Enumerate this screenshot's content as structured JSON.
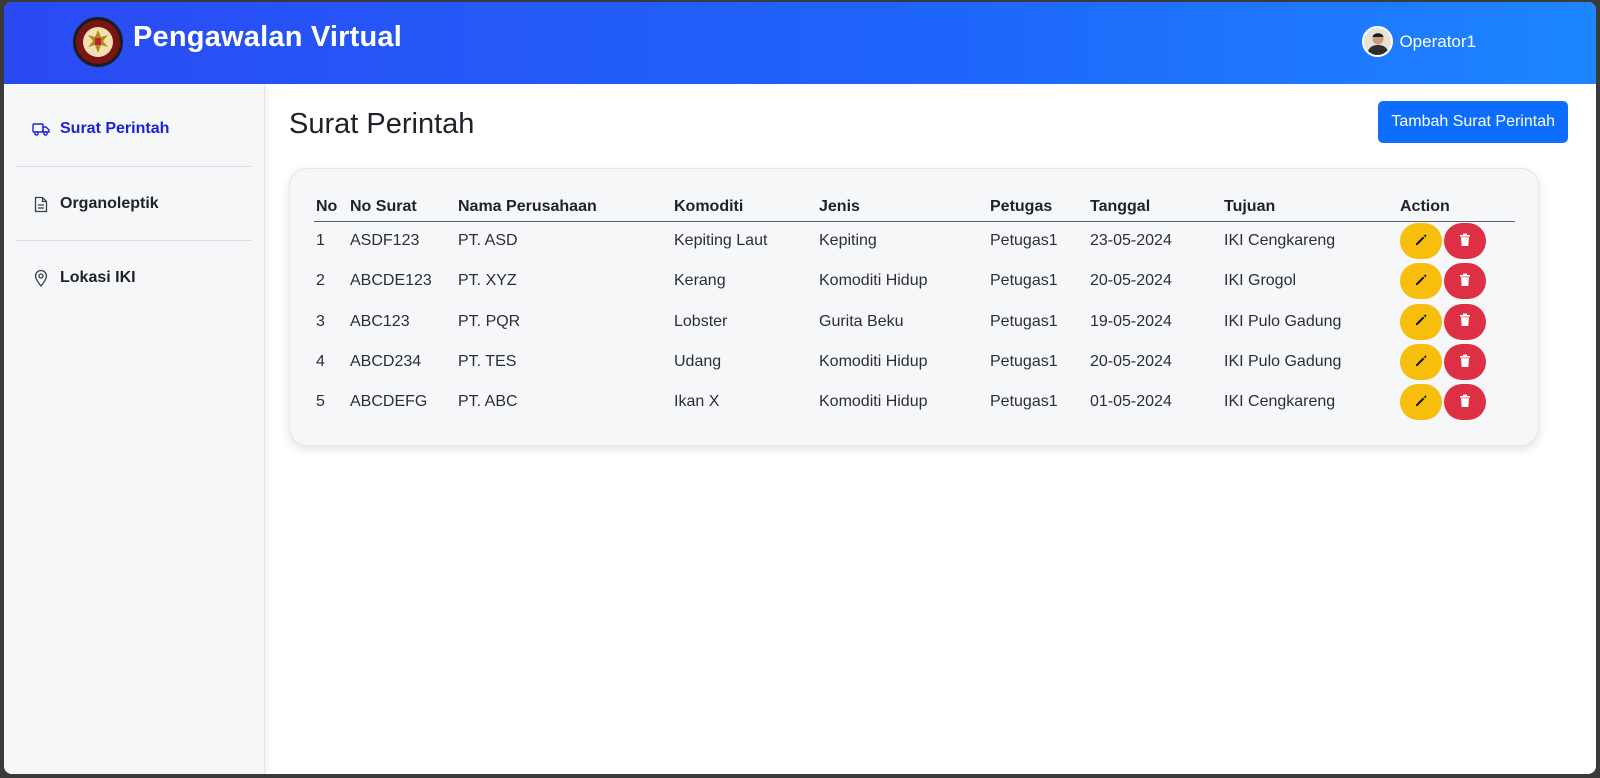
{
  "header": {
    "app_title": "Pengawalan Virtual",
    "user_name": "Operator1",
    "logo_icon": "garuda-emblem-icon"
  },
  "sidebar": {
    "items": [
      {
        "label": "Surat Perintah",
        "icon": "truck-icon",
        "active": true
      },
      {
        "label": "Organoleptik",
        "icon": "document-icon",
        "active": false
      },
      {
        "label": "Lokasi IKI",
        "icon": "location-pin-icon",
        "active": false
      }
    ]
  },
  "main": {
    "page_title": "Surat Perintah",
    "add_button_label": "Tambah Surat Perintah",
    "table": {
      "columns": [
        "No",
        "No Surat",
        "Nama Perusahaan",
        "Komoditi",
        "Jenis",
        "Petugas",
        "Tanggal",
        "Tujuan",
        "Action"
      ],
      "rows": [
        [
          "1",
          "ASDF123",
          "PT. ASD",
          "Kepiting Laut",
          "Kepiting",
          "Petugas1",
          "23-05-2024",
          "IKI Cengkareng"
        ],
        [
          "2",
          "ABCDE123",
          "PT. XYZ",
          "Kerang",
          "Komoditi Hidup",
          "Petugas1",
          "20-05-2024",
          "IKI Grogol"
        ],
        [
          "3",
          "ABC123",
          "PT. PQR",
          "Lobster",
          "Gurita Beku",
          "Petugas1",
          "19-05-2024",
          "IKI Pulo Gadung"
        ],
        [
          "4",
          "ABCD234",
          "PT. TES",
          "Udang",
          "Komoditi Hidup",
          "Petugas1",
          "20-05-2024",
          "IKI Pulo Gadung"
        ],
        [
          "5",
          "ABCDEFG",
          "PT. ABC",
          "Ikan X",
          "Komoditi Hidup",
          "Petugas1",
          "01-05-2024",
          "IKI Cengkareng"
        ]
      ]
    }
  },
  "colors": {
    "header_gradient_start": "#2a4af3",
    "header_gradient_end": "#1d86ff",
    "active_nav": "#1a22d6",
    "primary_button": "#0d6efd",
    "edit_button": "#f7be0d",
    "delete_button": "#dd3044"
  }
}
